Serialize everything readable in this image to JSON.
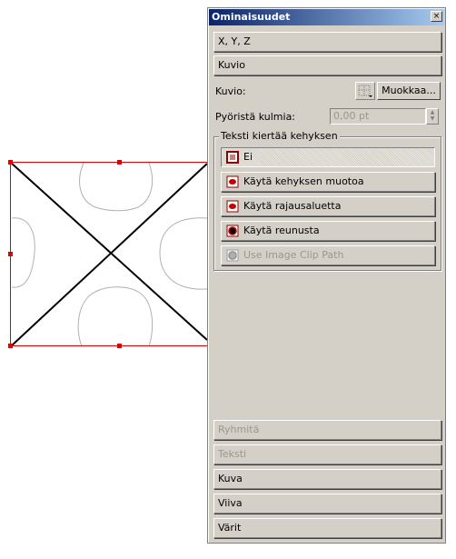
{
  "palette": {
    "title": "Ominaisuudet",
    "close_label": "×"
  },
  "sections_top": [
    {
      "label": "X, Y, Z"
    },
    {
      "label": "Kuvio"
    }
  ],
  "shape": {
    "label": "Kuvio:",
    "edit_button": "Muokkaa..."
  },
  "corners": {
    "label": "Pyöristä kulmia:",
    "value": "0,00 pt"
  },
  "text_wrap": {
    "legend": "Teksti kiertää kehyksen",
    "options": [
      {
        "label": "Ei",
        "selected": true,
        "enabled": true
      },
      {
        "label": "Käytä kehyksen muotoa",
        "selected": false,
        "enabled": true
      },
      {
        "label": "Käytä rajausaluetta",
        "selected": false,
        "enabled": true
      },
      {
        "label": "Käytä reunusta",
        "selected": false,
        "enabled": true
      },
      {
        "label": "Use Image Clip Path",
        "selected": false,
        "enabled": false
      }
    ]
  },
  "sections_bottom": [
    {
      "label": "Ryhmitä",
      "enabled": false
    },
    {
      "label": "Teksti",
      "enabled": false
    },
    {
      "label": "Kuva",
      "enabled": true
    },
    {
      "label": "Viiva",
      "enabled": true
    },
    {
      "label": "Värit",
      "enabled": true
    }
  ],
  "colors": {
    "selection_red": "#e00000",
    "titlebar_start": "#0a246a",
    "titlebar_end": "#a6caf0",
    "panel_bg": "#d4d0c8"
  }
}
